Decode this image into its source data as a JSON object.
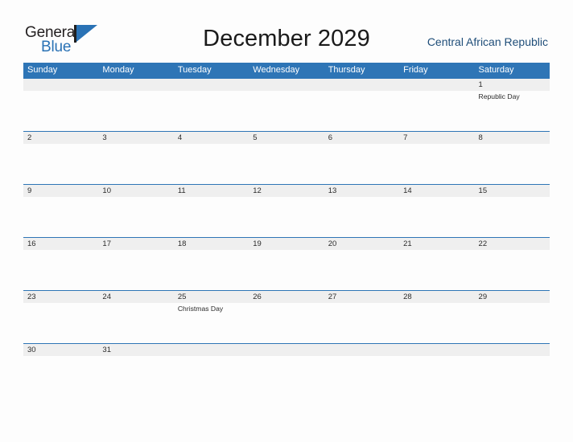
{
  "brand": {
    "name_top": "General",
    "name_bottom": "Blue",
    "accent_color": "#2a72b5"
  },
  "header": {
    "title": "December 2029",
    "country": "Central African Republic"
  },
  "theme": {
    "header_blue": "#2e75b6",
    "row_gray": "#efefef",
    "page_background": "#fdfdfd"
  },
  "calendar": {
    "weekdays": [
      "Sunday",
      "Monday",
      "Tuesday",
      "Wednesday",
      "Thursday",
      "Friday",
      "Saturday"
    ],
    "weeks": [
      {
        "days": [
          {
            "num": "",
            "event": ""
          },
          {
            "num": "",
            "event": ""
          },
          {
            "num": "",
            "event": ""
          },
          {
            "num": "",
            "event": ""
          },
          {
            "num": "",
            "event": ""
          },
          {
            "num": "",
            "event": ""
          },
          {
            "num": "1",
            "event": "Republic Day"
          }
        ]
      },
      {
        "days": [
          {
            "num": "2",
            "event": ""
          },
          {
            "num": "3",
            "event": ""
          },
          {
            "num": "4",
            "event": ""
          },
          {
            "num": "5",
            "event": ""
          },
          {
            "num": "6",
            "event": ""
          },
          {
            "num": "7",
            "event": ""
          },
          {
            "num": "8",
            "event": ""
          }
        ]
      },
      {
        "days": [
          {
            "num": "9",
            "event": ""
          },
          {
            "num": "10",
            "event": ""
          },
          {
            "num": "11",
            "event": ""
          },
          {
            "num": "12",
            "event": ""
          },
          {
            "num": "13",
            "event": ""
          },
          {
            "num": "14",
            "event": ""
          },
          {
            "num": "15",
            "event": ""
          }
        ]
      },
      {
        "days": [
          {
            "num": "16",
            "event": ""
          },
          {
            "num": "17",
            "event": ""
          },
          {
            "num": "18",
            "event": ""
          },
          {
            "num": "19",
            "event": ""
          },
          {
            "num": "20",
            "event": ""
          },
          {
            "num": "21",
            "event": ""
          },
          {
            "num": "22",
            "event": ""
          }
        ]
      },
      {
        "days": [
          {
            "num": "23",
            "event": ""
          },
          {
            "num": "24",
            "event": ""
          },
          {
            "num": "25",
            "event": "Christmas Day"
          },
          {
            "num": "26",
            "event": ""
          },
          {
            "num": "27",
            "event": ""
          },
          {
            "num": "28",
            "event": ""
          },
          {
            "num": "29",
            "event": ""
          }
        ]
      },
      {
        "days": [
          {
            "num": "30",
            "event": ""
          },
          {
            "num": "31",
            "event": ""
          },
          {
            "num": "",
            "event": ""
          },
          {
            "num": "",
            "event": ""
          },
          {
            "num": "",
            "event": ""
          },
          {
            "num": "",
            "event": ""
          },
          {
            "num": "",
            "event": ""
          }
        ]
      }
    ]
  }
}
